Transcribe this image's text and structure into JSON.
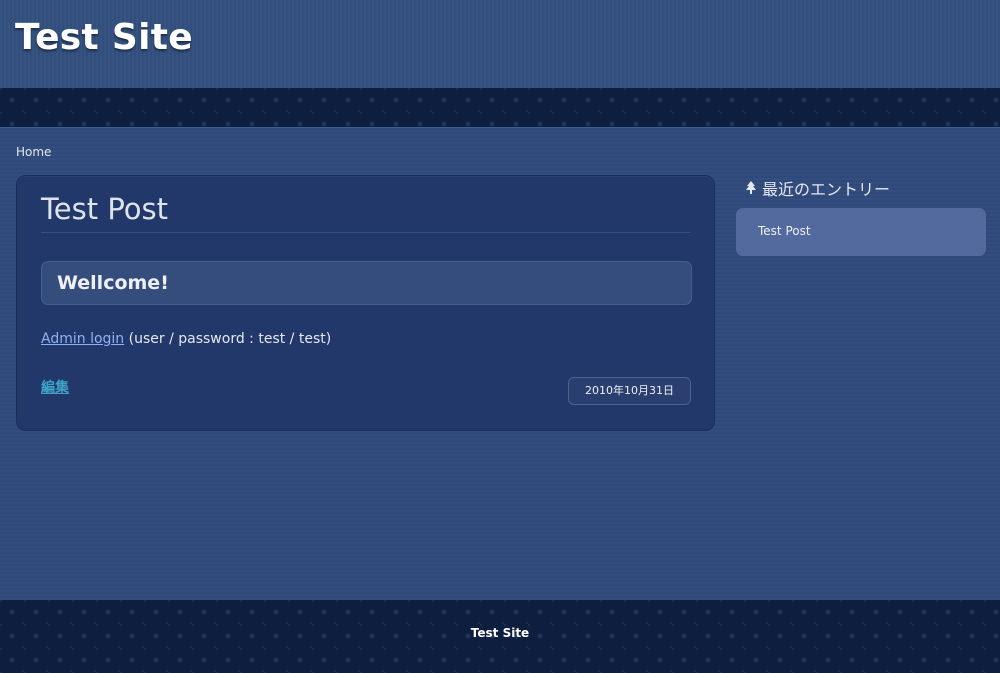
{
  "header": {
    "site_title": "Test Site"
  },
  "breadcrumb": {
    "home": "Home"
  },
  "post": {
    "title": "Test Post",
    "highlight": "Wellcome!",
    "admin_link": "Admin login",
    "credentials": " (user / password : test / test)",
    "edit_link": "編集",
    "date": "2010年10月31日"
  },
  "sidebar": {
    "heading": "最近のエントリー",
    "heading_icon": "tree-icon",
    "entries": [
      {
        "label": "Test Post"
      }
    ]
  },
  "footer": {
    "text": "Test Site"
  }
}
